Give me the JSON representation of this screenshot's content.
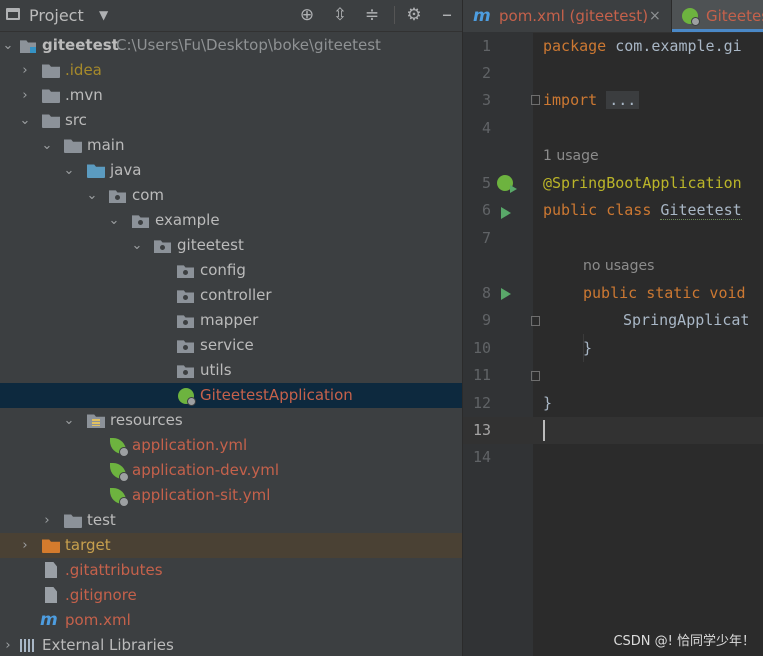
{
  "project_panel": {
    "title": "Project",
    "tools": [
      "locate-icon",
      "expand-all-icon",
      "collapse-all-icon",
      "gear-icon"
    ],
    "tree": [
      {
        "label": "giteetest",
        "path": "C:\\Users\\Fu\\Desktop\\boke\\giteetest",
        "icon": "project-icon",
        "expanded": true
      },
      {
        "label": ".idea",
        "icon": "folder-icon"
      },
      {
        "label": ".mvn",
        "icon": "folder-icon"
      },
      {
        "label": "src",
        "icon": "folder-icon",
        "expanded": true
      },
      {
        "label": "main",
        "icon": "folder-icon",
        "expanded": true
      },
      {
        "label": "java",
        "icon": "source-folder-icon",
        "expanded": true
      },
      {
        "label": "com",
        "icon": "package-icon",
        "expanded": true
      },
      {
        "label": "example",
        "icon": "package-icon",
        "expanded": true
      },
      {
        "label": "giteetest",
        "icon": "package-icon",
        "expanded": true
      },
      {
        "label": "config",
        "icon": "package-icon"
      },
      {
        "label": "controller",
        "icon": "package-icon"
      },
      {
        "label": "mapper",
        "icon": "package-icon"
      },
      {
        "label": "service",
        "icon": "package-icon"
      },
      {
        "label": "utils",
        "icon": "package-icon"
      },
      {
        "label": "GiteetestApplication",
        "icon": "spring-boot-class-icon",
        "selected": true
      },
      {
        "label": "resources",
        "icon": "resources-folder-icon",
        "expanded": true
      },
      {
        "label": "application.yml",
        "icon": "spring-config-icon"
      },
      {
        "label": "application-dev.yml",
        "icon": "spring-config-icon"
      },
      {
        "label": "application-sit.yml",
        "icon": "spring-config-icon"
      },
      {
        "label": "test",
        "icon": "folder-icon"
      },
      {
        "label": "target",
        "icon": "excluded-folder-icon"
      },
      {
        "label": ".gitattributes",
        "icon": "file-icon"
      },
      {
        "label": ".gitignore",
        "icon": "file-icon"
      },
      {
        "label": "pom.xml",
        "icon": "maven-icon"
      },
      {
        "label": "External Libraries",
        "icon": "libraries-icon"
      }
    ]
  },
  "editor": {
    "tabs": [
      {
        "label": "pom.xml (giteetest)",
        "icon": "maven-icon",
        "close": "×"
      },
      {
        "label": "Giteetest",
        "icon": "spring-boot-class-icon",
        "active": true
      }
    ],
    "line_numbers": [
      "1",
      "2",
      "3",
      "4",
      "5",
      "6",
      "7",
      "8",
      "9",
      "10",
      "11",
      "12",
      "13",
      "14"
    ],
    "hints": {
      "usage_1": "1 usage",
      "usage_2": "no usages"
    },
    "code": {
      "l1_kw": "package",
      "l1_rest": " com.example.gi",
      "l3_kw": "import",
      "l3_fold": "...",
      "l6": "@SpringBootApplication",
      "l7_kw": "public class",
      "l7_name": "Giteetest",
      "l9_kw": "public static void",
      "l10": "SpringApplicat",
      "l11": "}",
      "l13": "}"
    }
  },
  "watermark": "CSDN @! 恰同学少年！"
}
